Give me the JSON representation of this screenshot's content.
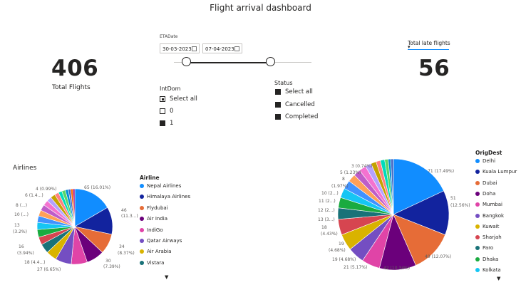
{
  "title": "Flight arrival dashboard",
  "kpi_total": {
    "value": "406",
    "label": "Total Flights"
  },
  "kpi_late": {
    "value": "56",
    "label": "Total late flights"
  },
  "date_slicer": {
    "label": "ETADate",
    "start": "30-03-2023",
    "end": "07-04-2023"
  },
  "intdom_slicer": {
    "title": "IntDom",
    "items": [
      {
        "label": "Select all",
        "state": "partial"
      },
      {
        "label": "0",
        "state": "empty"
      },
      {
        "label": "1",
        "state": "filled"
      }
    ]
  },
  "status_slicer": {
    "title": "Status",
    "items": [
      {
        "label": "Select all",
        "state": "filled"
      },
      {
        "label": "Cancelled",
        "state": "filled"
      },
      {
        "label": "Completed",
        "state": "filled"
      }
    ]
  },
  "airlines_chart": {
    "title": "Airlines",
    "legend_title": "Airline",
    "legend": [
      {
        "label": "Nepal Airlines",
        "color": "#118DFF"
      },
      {
        "label": "Himalaya Airlines",
        "color": "#12239E"
      },
      {
        "label": "Flydubai",
        "color": "#E66C37"
      },
      {
        "label": "Air India",
        "color": "#6B007B"
      },
      {
        "label": "IndiGo",
        "color": "#E044A7"
      },
      {
        "label": "Qatar Airways",
        "color": "#744EC2"
      },
      {
        "label": "Air Arabia",
        "color": "#D9B300"
      },
      {
        "label": "Vistara",
        "color": "#197278"
      }
    ],
    "slice_labels": [
      "65 (16.01%)",
      "46",
      "(11.3...)",
      "34",
      "(8.37%)",
      "30",
      "(7.39%)",
      "27 (6.65%)",
      "18 (4.4...)",
      "16",
      "(3.94%)",
      "13",
      "(3.2%)",
      "10 (...)",
      "8 (...)",
      "6 (1.4...)",
      "4 (0.99%)"
    ]
  },
  "origdest_chart": {
    "legend_title": "OrigDest",
    "legend": [
      {
        "label": "Delhi",
        "color": "#118DFF"
      },
      {
        "label": "Kuala Lumpur",
        "color": "#12239E"
      },
      {
        "label": "Dubai",
        "color": "#E66C37"
      },
      {
        "label": "Doha",
        "color": "#6B007B"
      },
      {
        "label": "Mumbai",
        "color": "#E044A7"
      },
      {
        "label": "Bangkok",
        "color": "#744EC2"
      },
      {
        "label": "Kuwait",
        "color": "#D9B300"
      },
      {
        "label": "Sharjah",
        "color": "#D64550"
      },
      {
        "label": "Paro",
        "color": "#197278"
      },
      {
        "label": "Dhaka",
        "color": "#1AAB40"
      },
      {
        "label": "Kolkata",
        "color": "#15C6F4"
      }
    ],
    "slice_labels": [
      "71 (17.49%)",
      "51",
      "(12.56%)",
      "49 (12.07%)",
      "42 (10.34%)",
      "21 (5.17%)",
      "19 (4.68%)",
      "19",
      "(4.68%)",
      "18",
      "(4.43%)",
      "13 (3...)",
      "12 (2...)",
      "11 (2...)",
      "10 (2...)",
      "8",
      "(1.97%)",
      "5 (1.23%)",
      "3 (0.74%)"
    ]
  },
  "chart_data": [
    {
      "type": "pie",
      "title": "Airlines",
      "legend_title": "Airline",
      "categories": [
        "Nepal Airlines",
        "Himalaya Airlines",
        "Flydubai",
        "Air India",
        "IndiGo",
        "Qatar Airways",
        "Air Arabia",
        "Vistara",
        "",
        "",
        "",
        "",
        "",
        "",
        "",
        "",
        "",
        "",
        "",
        "",
        "",
        "",
        "",
        ""
      ],
      "values": [
        65,
        46,
        34,
        30,
        27,
        27,
        18,
        16,
        13,
        13,
        12,
        11,
        10,
        10,
        9,
        8,
        8,
        7,
        6,
        6,
        5,
        4,
        4,
        3
      ],
      "colors": [
        "#118DFF",
        "#12239E",
        "#E66C37",
        "#6B007B",
        "#E044A7",
        "#744EC2",
        "#D9B300",
        "#197278",
        "#D64550",
        "#1AAB40",
        "#15C6F4",
        "#4092FF",
        "#FFA058",
        "#BE5DC9",
        "#F472D0",
        "#B5A1FF",
        "#C4A200",
        "#FF8080",
        "#00DBBC",
        "#5BD667",
        "#0091D5",
        "#4668C5",
        "#FF6300",
        "#99008A"
      ]
    },
    {
      "type": "pie",
      "legend_title": "OrigDest",
      "categories": [
        "Delhi",
        "Kuala Lumpur",
        "Dubai",
        "Doha",
        "Mumbai",
        "Bangkok",
        "Kuwait",
        "Sharjah",
        "Paro",
        "Dhaka",
        "Kolkata",
        "",
        "",
        "",
        "",
        "",
        "",
        "",
        "",
        "",
        "",
        ""
      ],
      "values": [
        71,
        51,
        49,
        42,
        21,
        19,
        19,
        18,
        13,
        12,
        11,
        10,
        9,
        8,
        8,
        7,
        6,
        5,
        5,
        4,
        3,
        3
      ],
      "colors": [
        "#118DFF",
        "#12239E",
        "#E66C37",
        "#6B007B",
        "#E044A7",
        "#744EC2",
        "#D9B300",
        "#D64550",
        "#197278",
        "#1AAB40",
        "#15C6F4",
        "#4092FF",
        "#FFA058",
        "#BE5DC9",
        "#F472D0",
        "#B5A1FF",
        "#C4A200",
        "#FF8080",
        "#00DBBC",
        "#5BD667",
        "#0091D5",
        "#4668C5"
      ]
    }
  ]
}
